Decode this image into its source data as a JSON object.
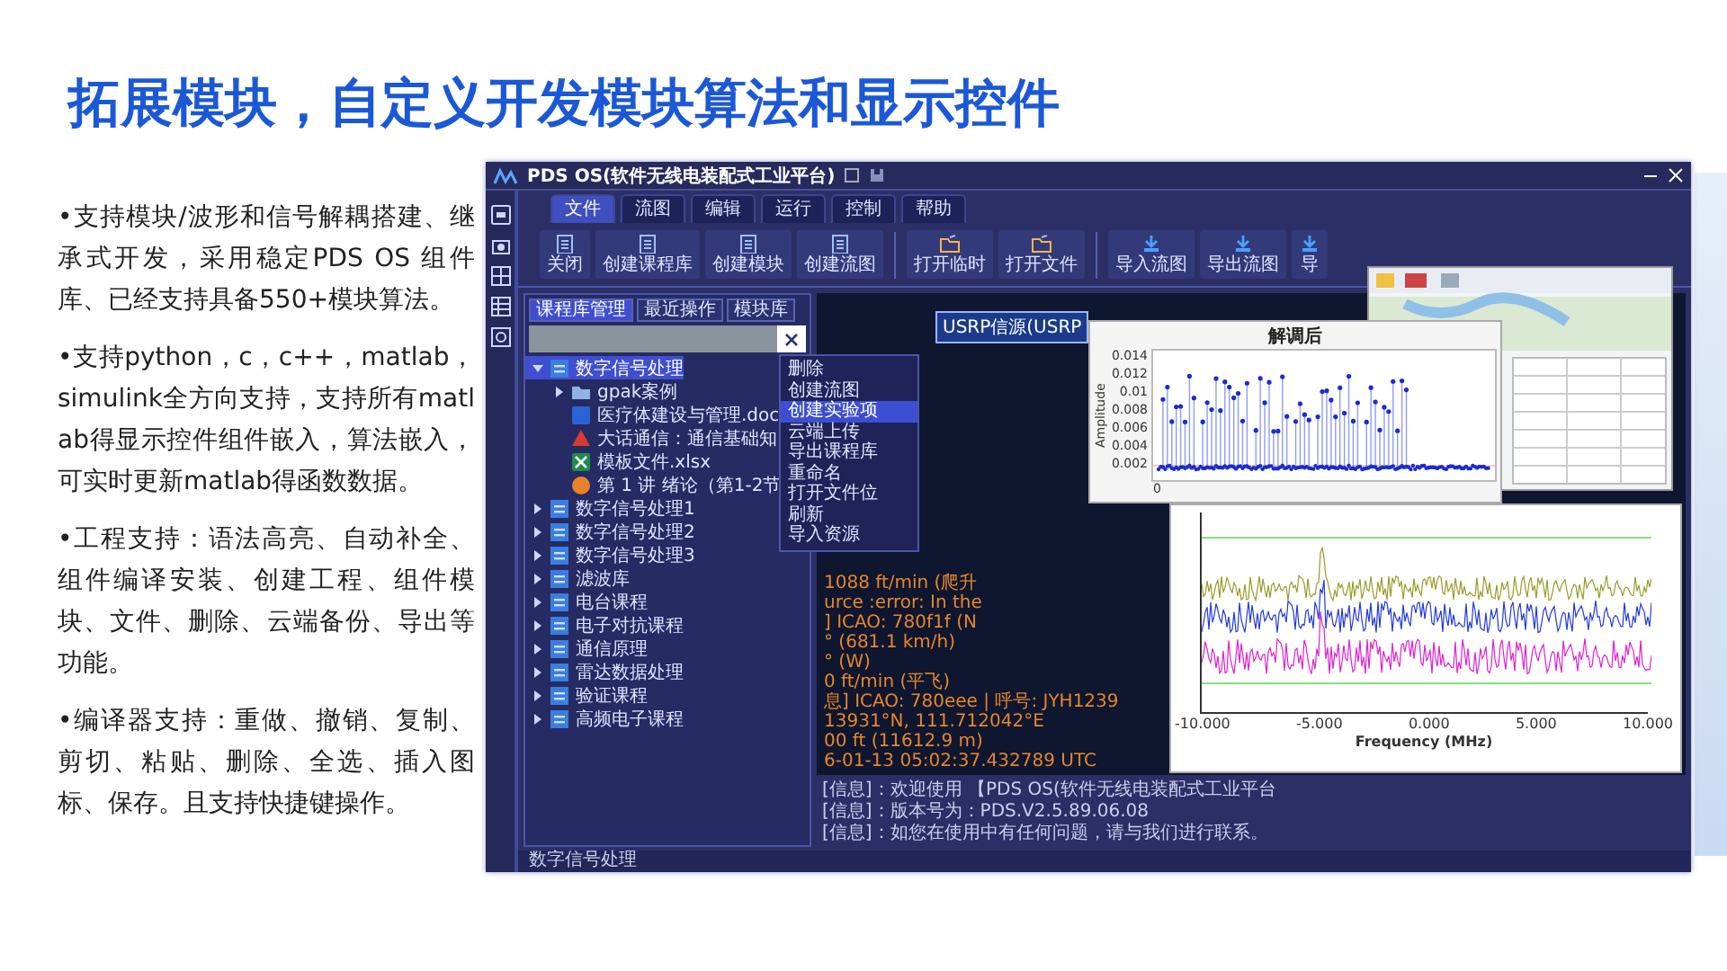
{
  "slide": {
    "title": "拓展模块，自定义开发模块算法和显示控件",
    "bullets": [
      "•支持模块/波形和信号解耦搭建、继承式开发，采用稳定PDS OS 组件库、已经支持具备550+模块算法。",
      "•支持python，c，c++，matlab，simulink全方向支持，支持所有matlab得显示控件组件嵌入，算法嵌入，可实时更新matlab得函数数据。",
      "•工程支持：语法高亮、自动补全、组件编译安装、创建工程、组件模块、文件、删除、云端备份、导出等功能。",
      "•编译器支持：重做、撤销、复制、剪切、粘贴、删除、全选、插入图标、保存。且支持快捷键操作。"
    ]
  },
  "app": {
    "title": "PDS OS(软件无线电装配式工业平台)",
    "menu_tabs": [
      {
        "label": "文件",
        "selected": true
      },
      {
        "label": "流图",
        "selected": false
      },
      {
        "label": "编辑",
        "selected": false
      },
      {
        "label": "运行",
        "selected": false
      },
      {
        "label": "控制",
        "selected": false
      },
      {
        "label": "帮助",
        "selected": false
      }
    ],
    "toolbar_groups": [
      [
        "关闭",
        "创建课程库",
        "创建模块",
        "创建流图"
      ],
      [
        "打开临时",
        "打开文件"
      ],
      [
        "导入流图",
        "导出流图",
        "导"
      ]
    ],
    "panel_tabs": [
      {
        "label": "课程库管理",
        "selected": true
      },
      {
        "label": "最近操作",
        "selected": false
      },
      {
        "label": "模块库",
        "selected": false
      }
    ],
    "tree": [
      {
        "label": "数字信号处理",
        "kind": "module",
        "expanded": true,
        "selected": true,
        "children": [
          {
            "label": "gpak案例",
            "kind": "folder",
            "expanded": false,
            "selected": false
          },
          {
            "label": "医疗体建设与管理.doc",
            "kind": "word",
            "selected": false
          },
          {
            "label": "大话通信：通信基础知",
            "kind": "pdf",
            "selected": false
          },
          {
            "label": "模板文件.xlsx",
            "kind": "excel",
            "selected": false
          },
          {
            "label": "第 1 讲 绪论（第1-2节",
            "kind": "ppt",
            "selected": false
          }
        ]
      },
      {
        "label": "数字信号处理1",
        "kind": "module",
        "expanded": false,
        "selected": false
      },
      {
        "label": "数字信号处理2",
        "kind": "module",
        "expanded": false,
        "selected": false
      },
      {
        "label": "数字信号处理3",
        "kind": "module",
        "expanded": false,
        "selected": false
      },
      {
        "label": "滤波库",
        "kind": "module",
        "expanded": false,
        "selected": false
      },
      {
        "label": "电台课程",
        "kind": "module",
        "expanded": false,
        "selected": false
      },
      {
        "label": "电子对抗课程",
        "kind": "module",
        "expanded": false,
        "selected": false
      },
      {
        "label": "通信原理",
        "kind": "module",
        "expanded": false,
        "selected": false
      },
      {
        "label": "雷达数据处理",
        "kind": "module",
        "expanded": false,
        "selected": false
      },
      {
        "label": "验证课程",
        "kind": "module",
        "expanded": false,
        "selected": false
      },
      {
        "label": "高频电子课程",
        "kind": "module",
        "expanded": false,
        "selected": false
      }
    ],
    "context_menu": [
      {
        "label": "删除",
        "selected": false
      },
      {
        "label": "创建流图",
        "selected": false
      },
      {
        "label": "创建实验项",
        "selected": true
      },
      {
        "label": "云端上传",
        "selected": false
      },
      {
        "label": "导出课程库",
        "selected": false
      },
      {
        "label": "重命名",
        "selected": false
      },
      {
        "label": "打开文件位",
        "selected": false
      },
      {
        "label": "刷新",
        "selected": false
      },
      {
        "label": "导入资源",
        "selected": false
      }
    ],
    "flow_node": "USRP信源(USRP",
    "log_lines": [
      "1088 ft/min (爬升",
      "urce :error: In the",
      "] ICAO: 780f1f (N",
      "° (681.1 km/h)",
      "° (W)",
      "0 ft/min (平飞)",
      "息] ICAO: 780eee | 呼号: JYH1239",
      "13931°N, 111.712042°E",
      "00 ft (11612.9 m)",
      "6-01-13 05:02:37.432789 UTC"
    ],
    "console_lines": [
      "[信息]：欢迎使用 【PDS OS(软件无线电装配式工业平台",
      "[信息]：版本号为：PDS.V2.5.89.06.08",
      "[信息]：如您在使用中有任何问题，请与我们进行联系。"
    ],
    "status": "数字信号处理"
  },
  "demod_plot": {
    "title": "解调后",
    "ylabel": "Amplitude",
    "yticks": [
      "0.014",
      "0.012",
      "0.01",
      "0.008",
      "0.006",
      "0.004",
      "0.002"
    ],
    "xticks": [
      "0"
    ]
  },
  "spectrum_plot": {
    "xlabel": "Frequency (MHz)",
    "xticks": [
      "-10.000",
      "-5.000",
      "0.000",
      "5.000",
      "10.000"
    ]
  }
}
